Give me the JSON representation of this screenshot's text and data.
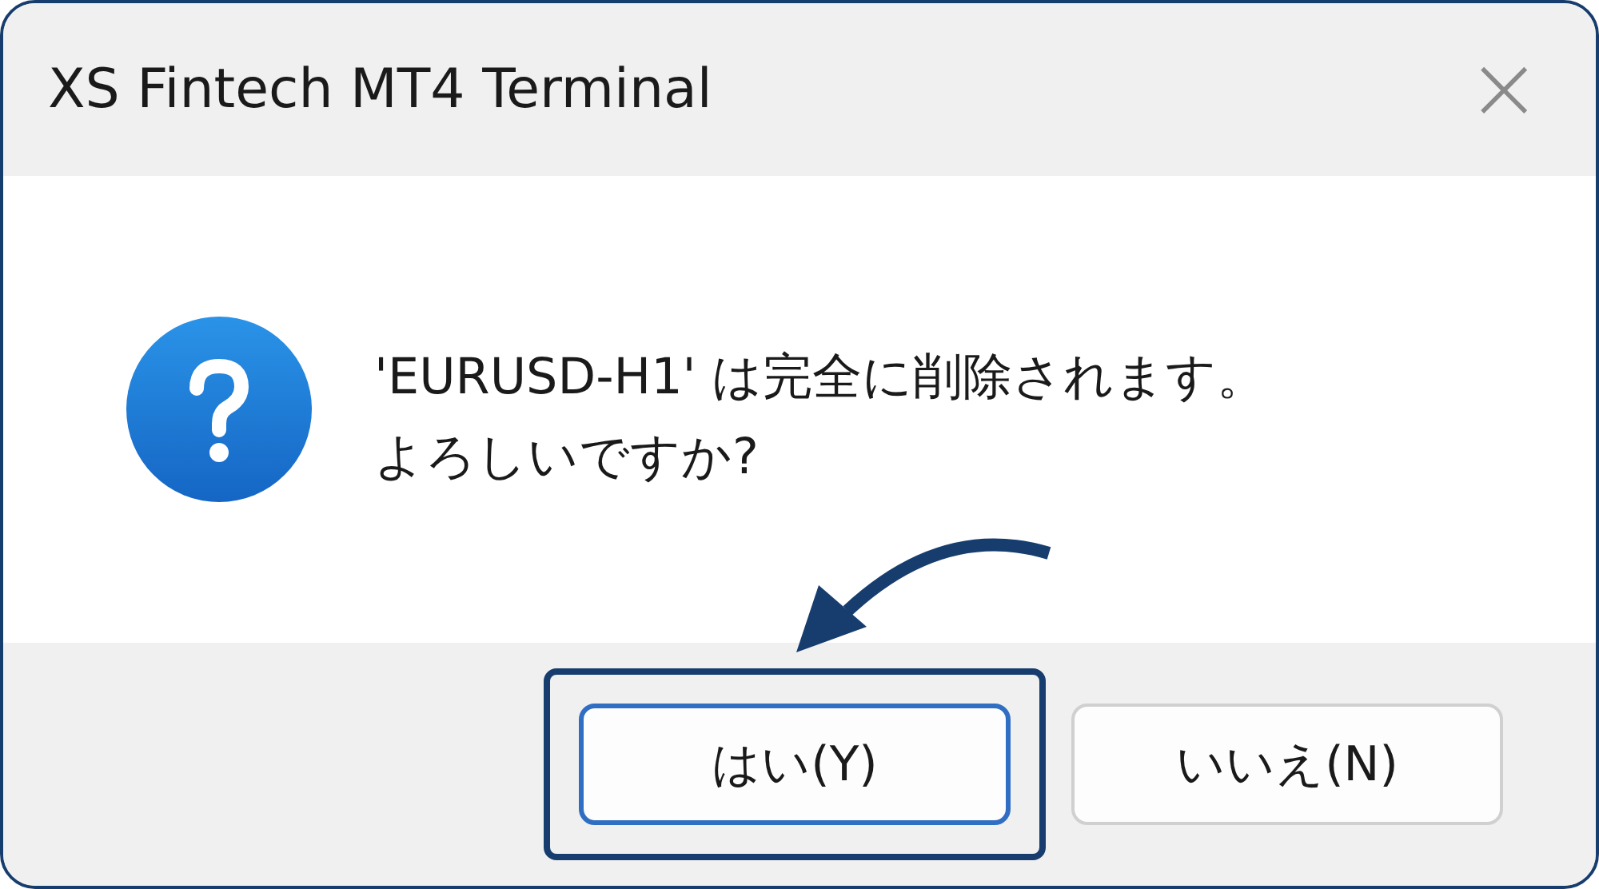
{
  "window": {
    "title": "XS Fintech MT4 Terminal",
    "close": "×"
  },
  "message": [
    "'EURUSD-H1' は完全に削除されます。",
    "よろしいですか?"
  ],
  "buttons": [
    {
      "label": "はい(Y)",
      "selected": true,
      "highlighted": true
    },
    {
      "label": "いいえ(N)",
      "selected": false,
      "highlighted": false
    }
  ]
}
